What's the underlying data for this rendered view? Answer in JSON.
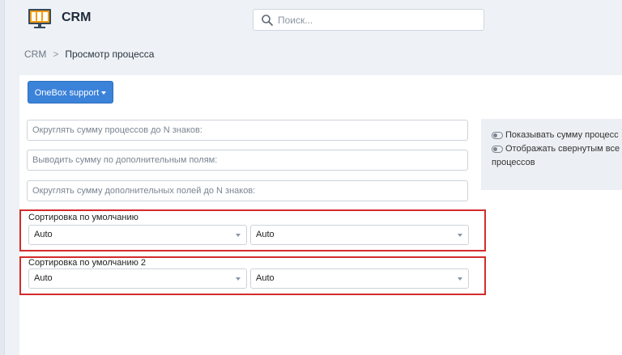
{
  "app": {
    "title": "CRM"
  },
  "search": {
    "placeholder": "Поиск..."
  },
  "breadcrumb": {
    "root": "CRM",
    "separator": ">",
    "current": "Просмотр процесса"
  },
  "toolbar": {
    "dropdown_label": "OneBox support"
  },
  "fields": [
    {
      "placeholder": "Округлять сумму процессов до N знаков:"
    },
    {
      "placeholder": "Выводить сумму по дополнительным полям:"
    },
    {
      "placeholder": "Округлять сумму дополнительных полей до N знаков:"
    }
  ],
  "side": {
    "toggle1": "Показывать сумму процесс",
    "toggle2": "Отображать свернутым все",
    "toggle2_cont": "процессов"
  },
  "sort1": {
    "label": "Сортировка по умолчанию",
    "select1": "Auto",
    "select2": "Auto"
  },
  "sort2": {
    "label": "Сортировка по умолчанию 2",
    "select1": "Auto",
    "select2": "Auto"
  },
  "colors": {
    "accent": "#3b82d9",
    "highlight": "#d42b2b",
    "background": "#eef2f6"
  }
}
